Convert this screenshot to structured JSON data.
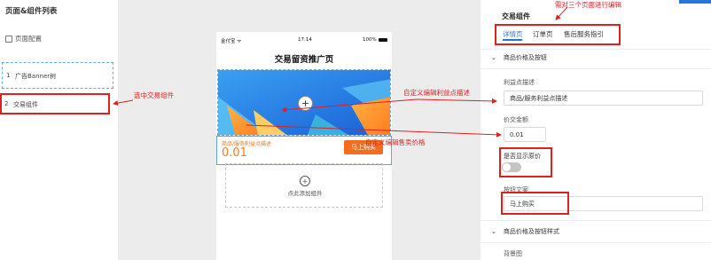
{
  "left_panel": {
    "title": "页面&组件列表",
    "page_config": "页面配置",
    "items": [
      {
        "index": "1",
        "label": "广告Banner树"
      },
      {
        "index": "2",
        "label": "交易组件"
      }
    ]
  },
  "phone": {
    "status_left": "金付宝 ᯤ",
    "status_time": "17:14",
    "status_right": "100%",
    "page_title": "交易留资推广页",
    "banner_add": "+",
    "trade": {
      "desc": "商品/服务利益点描述",
      "price": "0.01",
      "buy_label": "马上购买"
    },
    "add_component_icon": "+",
    "add_component_label": "点此添加组件"
  },
  "right_panel": {
    "title": "交易组件",
    "tabs": [
      "详情页",
      "订单页",
      "售后服务指引"
    ],
    "section1": "商品价格及按钮",
    "benefit_label": "利益点描述",
    "benefit_value": "商品/服务利益点描述",
    "price_label": "价交金额",
    "price_value": "0.01",
    "show_price_label": "是否显示原价",
    "button_text_label": "按钮文案",
    "button_text_value": "马上购买",
    "section2": "商品价格及按钮样式",
    "bg_label": "背景图"
  },
  "annotations": {
    "select_component": "选中交易组件",
    "three_pages": "需对三个页面进行编辑",
    "edit_benefit": "自定义编辑利益点描述",
    "edit_price": "自定义编辑售卖价格"
  },
  "colors": {
    "accent": "#2a74d4",
    "buy_orange": "#f36d1f",
    "annotation_red": "#e02020"
  }
}
